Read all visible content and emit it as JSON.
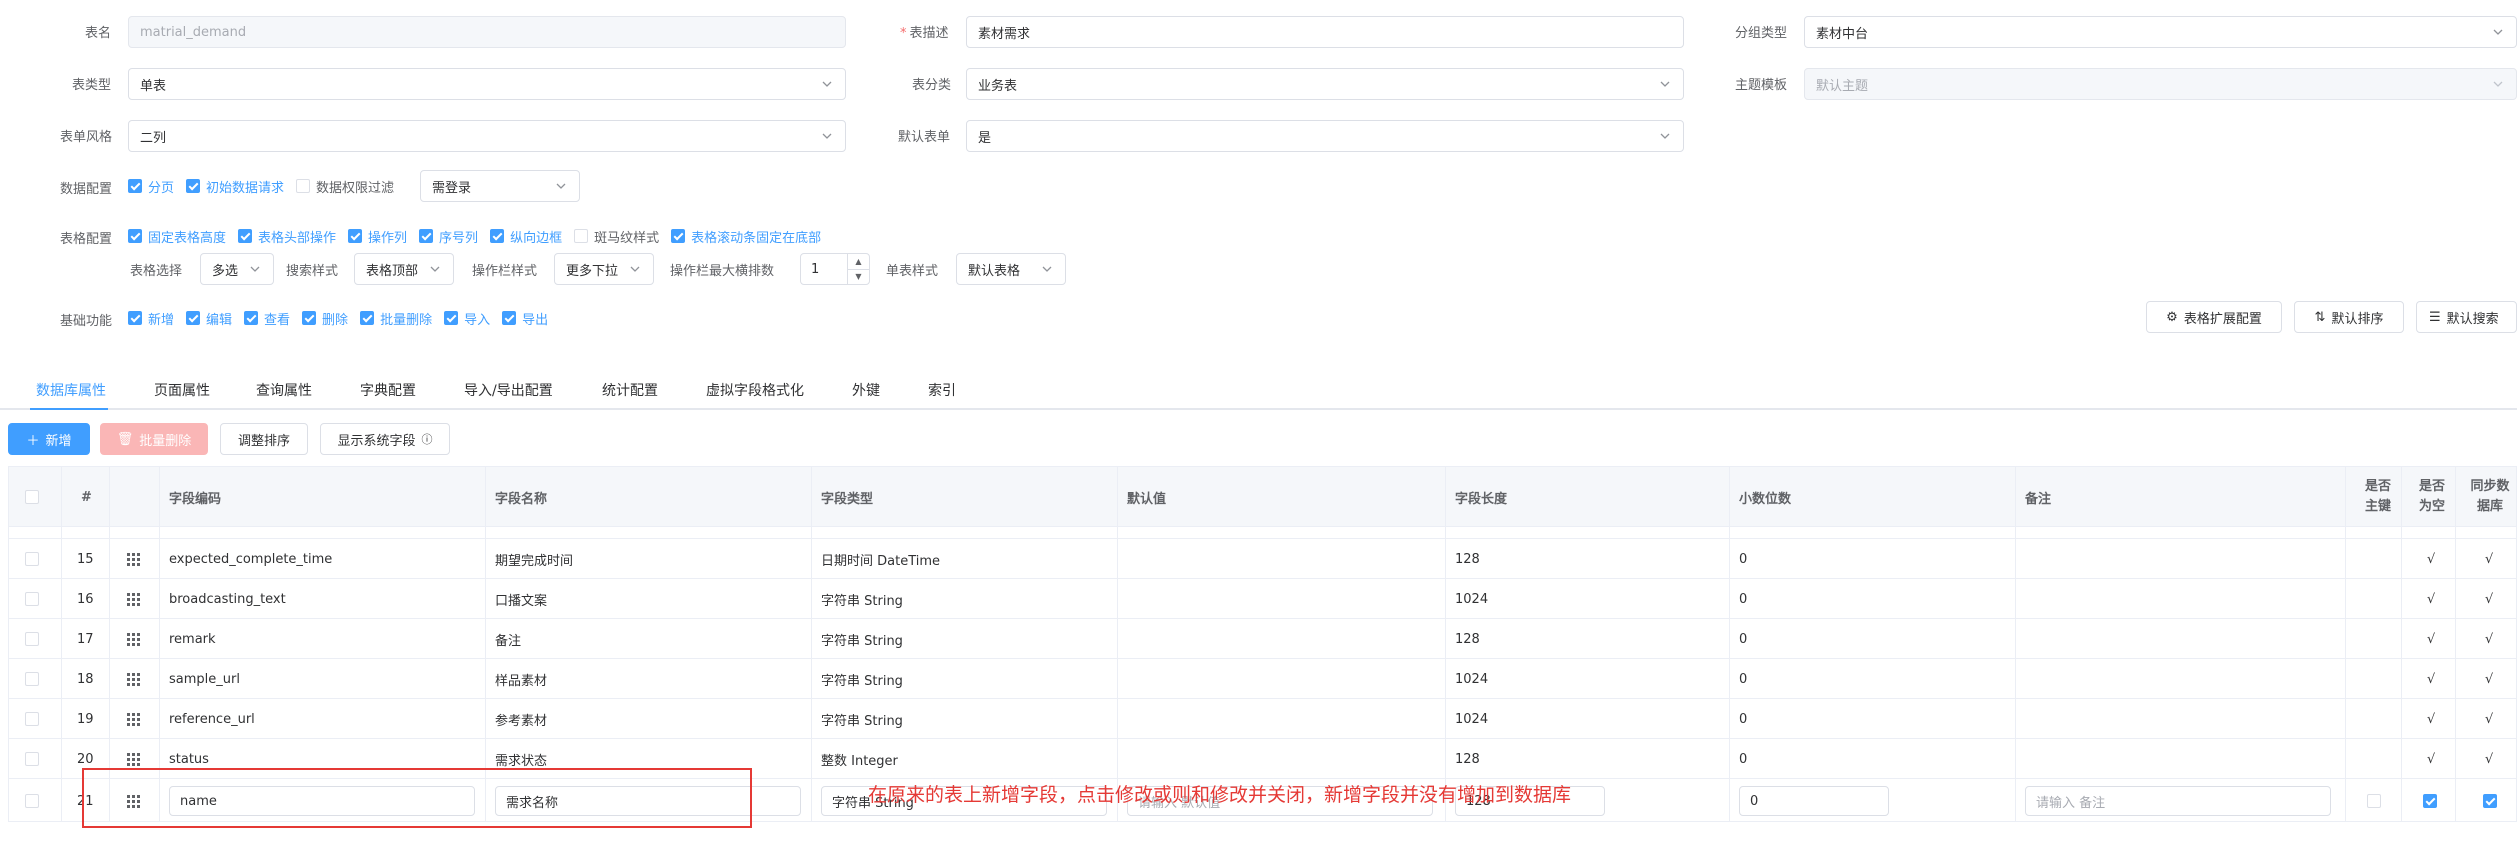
{
  "form": {
    "table_name": {
      "label": "表名",
      "value": "matrial_demand"
    },
    "table_desc": {
      "label": "表描述",
      "required_mark": "*",
      "value": "素材需求"
    },
    "group_type": {
      "label": "分组类型",
      "value": "素材中台"
    },
    "table_type": {
      "label": "表类型",
      "value": "单表"
    },
    "table_category": {
      "label": "表分类",
      "value": "业务表"
    },
    "theme_template": {
      "label": "主题模板",
      "value": "默认主题"
    },
    "form_style": {
      "label": "表单风格",
      "value": "二列"
    },
    "default_form": {
      "label": "默认表单",
      "value": "是"
    }
  },
  "data_config": {
    "label": "数据配置",
    "options": [
      {
        "label": "分页",
        "checked": true
      },
      {
        "label": "初始数据请求",
        "checked": true
      },
      {
        "label": "数据权限过滤",
        "checked": false
      }
    ],
    "permission_select": "需登录"
  },
  "table_config": {
    "label": "表格配置",
    "options": [
      {
        "label": "固定表格高度",
        "checked": true
      },
      {
        "label": "表格头部操作",
        "checked": true
      },
      {
        "label": "操作列",
        "checked": true
      },
      {
        "label": "序号列",
        "checked": true
      },
      {
        "label": "纵向边框",
        "checked": true
      },
      {
        "label": "斑马纹样式",
        "checked": false
      },
      {
        "label": "表格滚动条固定在底部",
        "checked": true
      }
    ],
    "table_select_label": "表格选择",
    "table_select_value": "多选",
    "search_style_label": "搜索样式",
    "search_style_value": "表格顶部",
    "op_style_label": "操作栏样式",
    "op_style_value": "更多下拉",
    "op_max_label": "操作栏最大横排数",
    "op_max_value": "1",
    "single_style_label": "单表样式",
    "single_style_value": "默认表格"
  },
  "basic_func": {
    "label": "基础功能",
    "options": [
      {
        "label": "新增",
        "checked": true
      },
      {
        "label": "编辑",
        "checked": true
      },
      {
        "label": "查看",
        "checked": true
      },
      {
        "label": "删除",
        "checked": true
      },
      {
        "label": "批量删除",
        "checked": true
      },
      {
        "label": "导入",
        "checked": true
      },
      {
        "label": "导出",
        "checked": true
      }
    ]
  },
  "right_buttons": {
    "ext_config": "表格扩展配置",
    "default_sort": "默认排序",
    "default_search": "默认搜索"
  },
  "tabs": [
    "数据库属性",
    "页面属性",
    "查询属性",
    "字典配置",
    "导入/导出配置",
    "统计配置",
    "虚拟字段格式化",
    "外键",
    "索引"
  ],
  "toolbar": {
    "add": "新增",
    "batch_delete": "批量删除",
    "adjust_sort": "调整排序",
    "show_system_fields": "显示系统字段"
  },
  "grid": {
    "headers": {
      "index": "#",
      "code": "字段编码",
      "name": "字段名称",
      "type": "字段类型",
      "default": "默认值",
      "length": "字段长度",
      "decimal": "小数位数",
      "remark": "备注",
      "pk_1": "是否",
      "pk_2": "主键",
      "nullable_1": "是否",
      "nullable_2": "为空",
      "sync_1": "同步数",
      "sync_2": "据库"
    },
    "rows": [
      {
        "no": "15",
        "code": "expected_complete_time",
        "name": "期望完成时间",
        "type": "日期时间 DateTime",
        "length": "128",
        "decimal": "0",
        "nullable": "√",
        "sync": "√"
      },
      {
        "no": "16",
        "code": "broadcasting_text",
        "name": "口播文案",
        "type": "字符串 String",
        "length": "1024",
        "decimal": "0",
        "nullable": "√",
        "sync": "√"
      },
      {
        "no": "17",
        "code": "remark",
        "name": "备注",
        "type": "字符串 String",
        "length": "128",
        "decimal": "0",
        "nullable": "√",
        "sync": "√"
      },
      {
        "no": "18",
        "code": "sample_url",
        "name": "样品素材",
        "type": "字符串 String",
        "length": "1024",
        "decimal": "0",
        "nullable": "√",
        "sync": "√"
      },
      {
        "no": "19",
        "code": "reference_url",
        "name": "参考素材",
        "type": "字符串 String",
        "length": "1024",
        "decimal": "0",
        "nullable": "√",
        "sync": "√"
      },
      {
        "no": "20",
        "code": "status",
        "name": "需求状态",
        "type": "整数 Integer",
        "length": "128",
        "decimal": "0",
        "nullable": "√",
        "sync": "√"
      }
    ],
    "edit_row": {
      "no": "21",
      "code": "name",
      "name": "需求名称",
      "type": "字符串 String",
      "default_placeholder": "请输入 默认值",
      "length": "128",
      "decimal": "0",
      "remark_placeholder": "请输入 备注"
    }
  },
  "annotation": {
    "text": "在原来的表上新增字段，点击修改或则和修改并关闭，新增字段并没有增加到数据库",
    "color": "#e53935"
  }
}
